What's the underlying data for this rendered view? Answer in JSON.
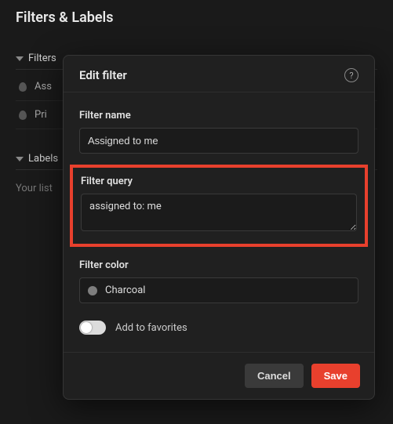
{
  "page": {
    "title": "Filters & Labels"
  },
  "sections": {
    "filters_label": "Filters",
    "labels_label": "Labels"
  },
  "bg_items": {
    "item1": "Ass",
    "item2": "Pri"
  },
  "note": "Your list",
  "dialog": {
    "title": "Edit filter",
    "help_glyph": "?",
    "filter_name_label": "Filter name",
    "filter_name_value": "Assigned to me",
    "filter_query_label": "Filter query",
    "filter_query_value": "assigned to: me",
    "filter_color_label": "Filter color",
    "filter_color_value": "Charcoal",
    "filter_color_hex": "#7e7e7e",
    "add_to_favorites_label": "Add to favorites",
    "add_to_favorites_on": false,
    "cancel": "Cancel",
    "save": "Save"
  }
}
